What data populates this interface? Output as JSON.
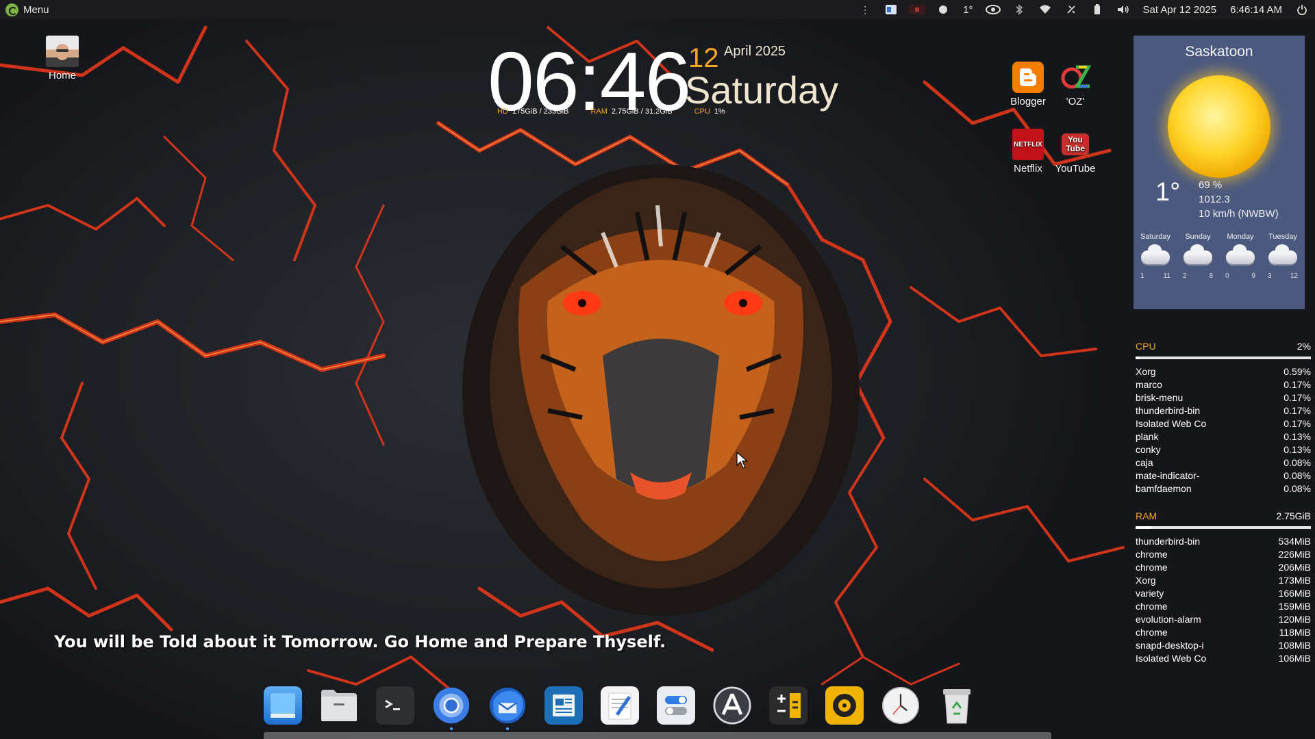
{
  "top_panel": {
    "menu_label": "Menu",
    "temperature": "1°",
    "date": "Sat Apr 12 2025",
    "time": "6:46:14 AM"
  },
  "desktop_icons": {
    "home": "Home",
    "blogger": "Blogger",
    "oz": "'OZ'",
    "netflix": "Netflix",
    "netflix_logo_text": "NETFLIX",
    "youtube": "YouTube",
    "youtube_logo_text": "You Tube"
  },
  "clock": {
    "time": "06:46",
    "day": "12",
    "month_year": "April 2025",
    "weekday": "Saturday",
    "hd_label": "HD",
    "hd_value": "175GiB / 233GiB",
    "ram_label": "RAM",
    "ram_value": "2.75GiB / 31.2GiB",
    "cpu_label": "CPU",
    "cpu_value": "1%"
  },
  "weather": {
    "city": "Saskatoon",
    "temperature": "1°",
    "humidity": "69 %",
    "pressure": "1012.3",
    "wind": "10 km/h (NWBW)",
    "forecast": [
      {
        "day": "Saturday",
        "lo": "1",
        "hi": "11"
      },
      {
        "day": "Sunday",
        "lo": "2",
        "hi": "8"
      },
      {
        "day": "Monday",
        "lo": "0",
        "hi": "9"
      },
      {
        "day": "Tuesday",
        "lo": "3",
        "hi": "12"
      }
    ]
  },
  "cpu": {
    "label": "CPU",
    "total": "2%",
    "usage_fraction": 0.02,
    "processes": [
      {
        "name": "Xorg",
        "value": "0.59%"
      },
      {
        "name": "marco",
        "value": "0.17%"
      },
      {
        "name": "brisk-menu",
        "value": "0.17%"
      },
      {
        "name": "thunderbird-bin",
        "value": "0.17%"
      },
      {
        "name": "Isolated Web Co",
        "value": "0.17%"
      },
      {
        "name": "plank",
        "value": "0.13%"
      },
      {
        "name": "conky",
        "value": "0.13%"
      },
      {
        "name": "caja",
        "value": "0.08%"
      },
      {
        "name": "mate-indicator-",
        "value": "0.08%"
      },
      {
        "name": "bamfdaemon",
        "value": "0.08%"
      }
    ]
  },
  "ram": {
    "label": "RAM",
    "total": "2.75GiB",
    "usage_fraction": 0.09,
    "processes": [
      {
        "name": "thunderbird-bin",
        "value": "534MiB"
      },
      {
        "name": "chrome",
        "value": "226MiB"
      },
      {
        "name": "chrome",
        "value": "206MiB"
      },
      {
        "name": "Xorg",
        "value": "173MiB"
      },
      {
        "name": "variety",
        "value": "166MiB"
      },
      {
        "name": "chrome",
        "value": "159MiB"
      },
      {
        "name": "evolution-alarm",
        "value": "120MiB"
      },
      {
        "name": "chrome",
        "value": "118MiB"
      },
      {
        "name": "snapd-desktop-i",
        "value": "108MiB"
      },
      {
        "name": "Isolated Web Co",
        "value": "106MiB"
      }
    ]
  },
  "quote": "You will be Told about it Tomorrow.  Go Home and Prepare Thyself.",
  "dock": [
    {
      "icon": "desktop-icon",
      "color": "#3b8fe6"
    },
    {
      "icon": "files-icon",
      "color": "#9aa1a8"
    },
    {
      "icon": "terminal-icon",
      "color": "#2e2f33"
    },
    {
      "icon": "chromium-icon",
      "color": "#2f7be5"
    },
    {
      "icon": "thunderbird-icon",
      "color": "#2065c9"
    },
    {
      "icon": "text-editor-icon",
      "color": "#1d6fb8"
    },
    {
      "icon": "notes-icon",
      "color": "#f2f2f2"
    },
    {
      "icon": "settings-icon",
      "color": "#e9ecf0"
    },
    {
      "icon": "software-icon",
      "color": "#3a3d44"
    },
    {
      "icon": "calculator-icon",
      "color": "#2b2b2b"
    },
    {
      "icon": "music-icon",
      "color": "#f0b400"
    },
    {
      "icon": "clock-icon",
      "color": "#f3f3f3"
    },
    {
      "icon": "trash-icon",
      "color": "#d7d7d7"
    }
  ]
}
